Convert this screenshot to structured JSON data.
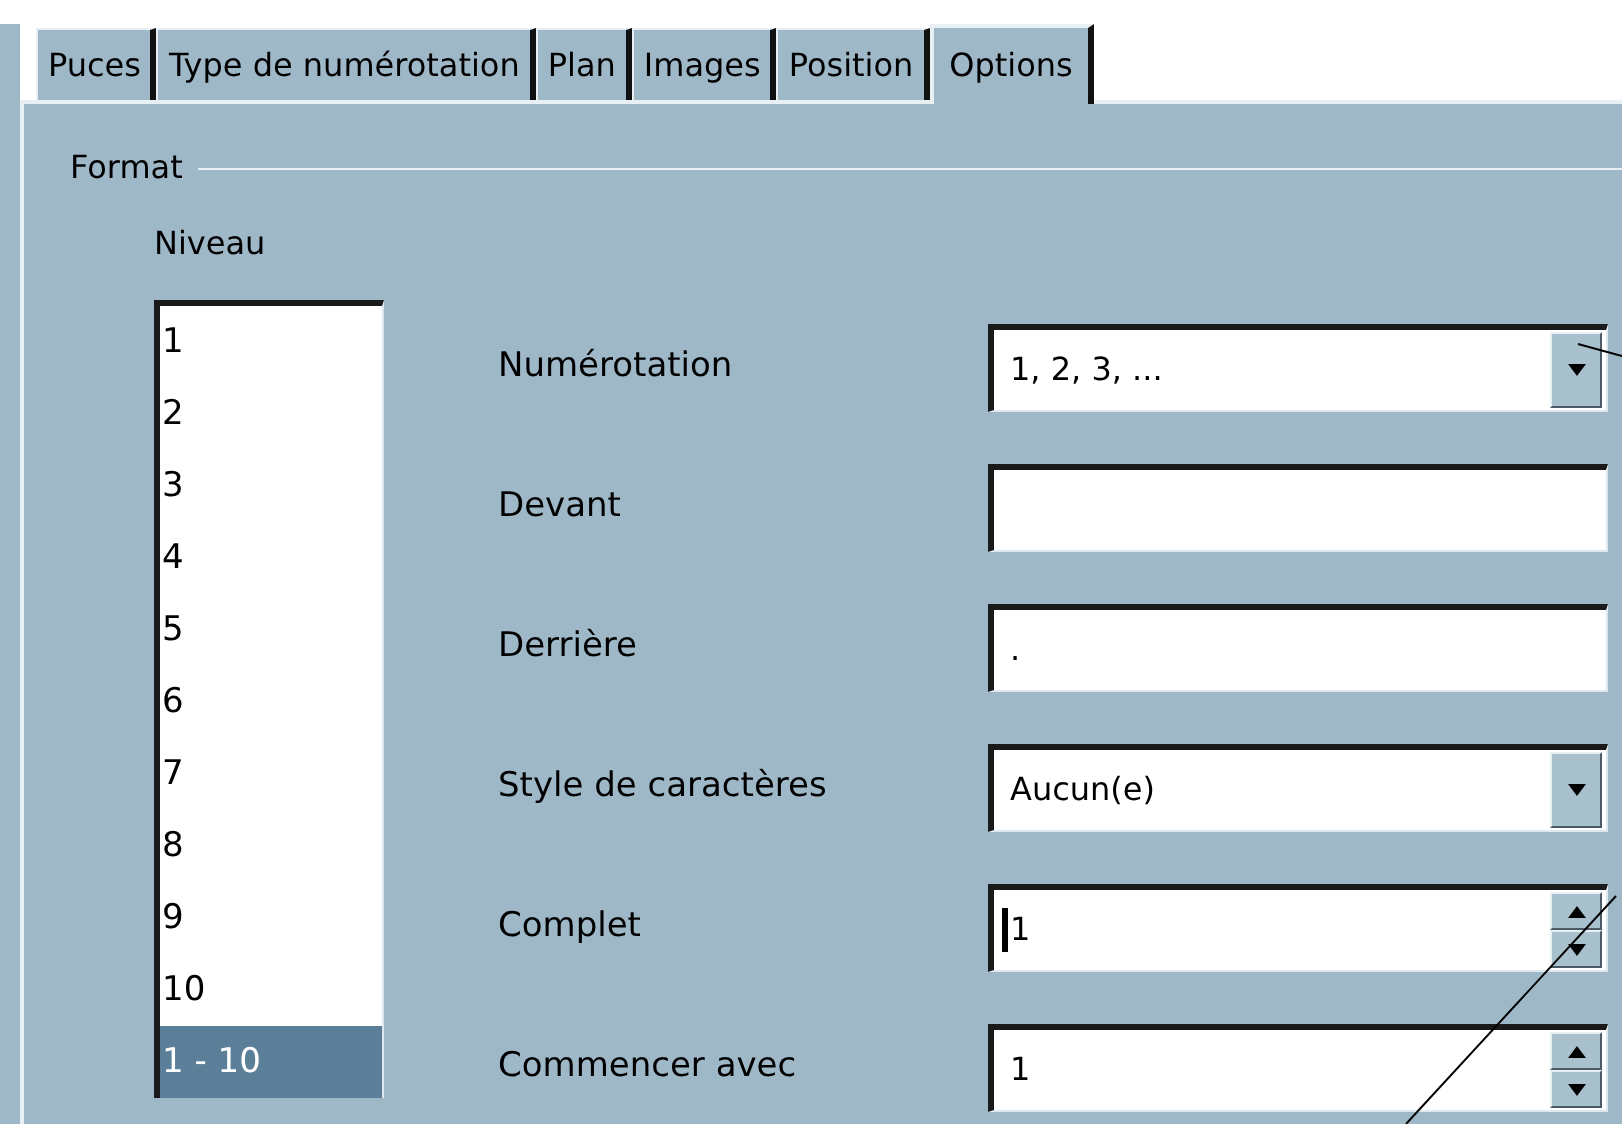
{
  "tabs": [
    {
      "label": "Puces",
      "selected": false
    },
    {
      "label": "Type de numérotation",
      "selected": false
    },
    {
      "label": "Plan",
      "selected": false
    },
    {
      "label": "Images",
      "selected": false
    },
    {
      "label": "Position",
      "selected": false
    },
    {
      "label": "Options",
      "selected": true
    }
  ],
  "format": {
    "title": "Format",
    "level_label": "Niveau",
    "levels": [
      {
        "label": "1",
        "selected": false
      },
      {
        "label": "2",
        "selected": false
      },
      {
        "label": "3",
        "selected": false
      },
      {
        "label": "4",
        "selected": false
      },
      {
        "label": "5",
        "selected": false
      },
      {
        "label": "6",
        "selected": false
      },
      {
        "label": "7",
        "selected": false
      },
      {
        "label": "8",
        "selected": false
      },
      {
        "label": "9",
        "selected": false
      },
      {
        "label": "10",
        "selected": false
      },
      {
        "label": "1 - 10",
        "selected": true
      }
    ],
    "fields": [
      {
        "label": "Numérotation",
        "kind": "dropdown",
        "value": "1, 2, 3, ...",
        "focused": false
      },
      {
        "label": "Devant",
        "kind": "text",
        "focused": false
      },
      {
        "label": "Derrière",
        "kind": "text",
        "value": ".",
        "focused": false
      },
      {
        "label": "Style de caractères",
        "kind": "dropdown",
        "value": "Aucun(e)",
        "focused": false
      },
      {
        "label": "Complet",
        "kind": "spin",
        "value": "1",
        "focused": true
      },
      {
        "label": "Commencer avec",
        "kind": "spin",
        "value": "1",
        "focused": false
      }
    ]
  }
}
